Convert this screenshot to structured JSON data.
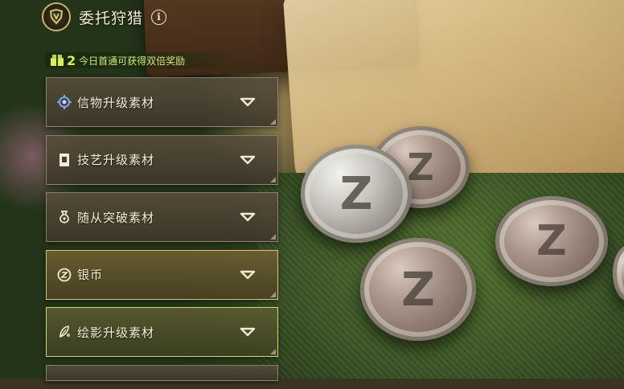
{
  "header": {
    "title": "委托狩猎",
    "info_glyph": "i",
    "emblem_icon": "hunt-emblem-icon"
  },
  "bonus": {
    "icon": "double-reward-icon",
    "multiplier": "2",
    "text": "今日首通可获得双倍奖励"
  },
  "categories": [
    {
      "label": "信物升级素材",
      "icon": "token-gear-icon",
      "state": "normal"
    },
    {
      "label": "技艺升级素材",
      "icon": "skill-book-icon",
      "state": "normal"
    },
    {
      "label": "随从突破素材",
      "icon": "pouch-icon",
      "state": "normal"
    },
    {
      "label": "银币",
      "icon": "silver-coin-icon",
      "state": "selected"
    },
    {
      "label": "绘影升级素材",
      "icon": "feather-icon",
      "state": "highlighted"
    }
  ],
  "colors": {
    "accent_gold": "#d9c27a",
    "accent_green": "#c8dc6a",
    "text_light": "#f4eed8"
  }
}
